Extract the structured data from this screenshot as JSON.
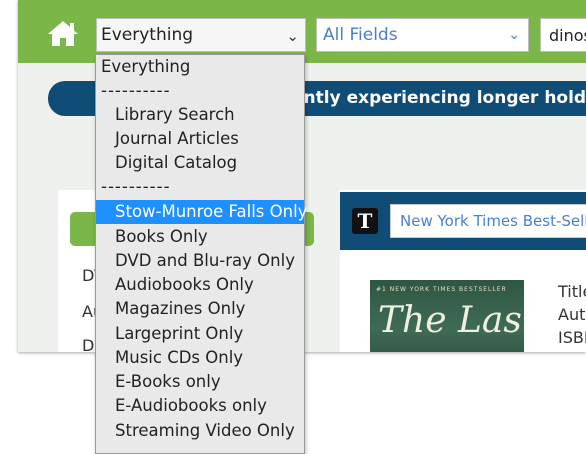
{
  "header": {
    "home_icon": "home-icon",
    "scope_value": "Everything",
    "field_value": "All Fields",
    "search_value": "dinos",
    "colors": {
      "bar": "#7ab648",
      "navy": "#0f4c76"
    }
  },
  "alert": {
    "text": "ently experiencing longer hold deli"
  },
  "left_panel": {
    "items": [
      "DV",
      "Au",
      "Do"
    ]
  },
  "nyt": {
    "logo": "T",
    "select_value": "New York Times Best-Seller",
    "book_title": "The Last",
    "book_tag": "#1 NEW YORK TIMES BESTSELLER",
    "meta": [
      "Title",
      "Auth",
      "ISBN"
    ]
  },
  "dropdown": {
    "options": [
      {
        "label": "Everything",
        "kind": "group"
      },
      {
        "label": "----------",
        "kind": "sep"
      },
      {
        "label": "Library Search",
        "kind": "opt"
      },
      {
        "label": "Journal Articles",
        "kind": "opt"
      },
      {
        "label": "Digital Catalog",
        "kind": "opt"
      },
      {
        "label": "----------",
        "kind": "sep"
      },
      {
        "label": "Stow-Munroe Falls Only",
        "kind": "opt",
        "selected": true
      },
      {
        "label": "Books Only",
        "kind": "opt"
      },
      {
        "label": "DVD and Blu-ray Only",
        "kind": "opt"
      },
      {
        "label": "Audiobooks Only",
        "kind": "opt"
      },
      {
        "label": "Magazines Only",
        "kind": "opt"
      },
      {
        "label": "Largeprint Only",
        "kind": "opt"
      },
      {
        "label": "Music CDs Only",
        "kind": "opt"
      },
      {
        "label": "E-Books only",
        "kind": "opt"
      },
      {
        "label": "E-Audiobooks only",
        "kind": "opt"
      },
      {
        "label": "Streaming Video Only",
        "kind": "opt"
      }
    ]
  }
}
